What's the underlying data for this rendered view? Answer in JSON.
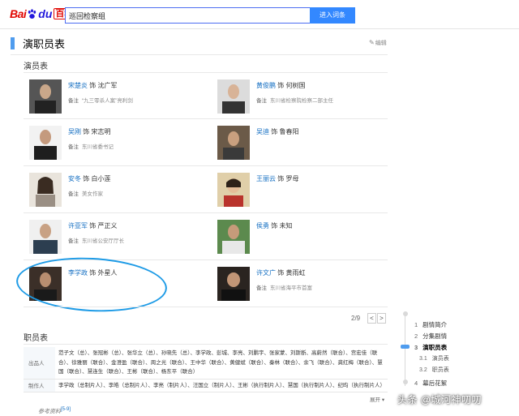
{
  "header": {
    "logo_bai": "Bai",
    "logo_du": "du",
    "logo_baike": "百科",
    "search_value": "巡回检察组",
    "search_button": "进入词条"
  },
  "section": {
    "title": "演职员表",
    "edit": "编辑"
  },
  "cast": {
    "title": "演员表",
    "role_prefix": "饰",
    "note_label": "备注",
    "actors": [
      {
        "name": "宋楚炎",
        "role": "沈广军",
        "note": "“九三零杀人案”亮利剑"
      },
      {
        "name": "黄俊鹏",
        "role": "何树国",
        "note": "东川省检察院检察二部主任"
      },
      {
        "name": "吴刚",
        "role": "宋志明",
        "note": "东川省委书记"
      },
      {
        "name": "吴迪",
        "role": "鲁春阳",
        "note": ""
      },
      {
        "name": "安冬",
        "role": "白小莲",
        "note": "美女作家"
      },
      {
        "name": "王丽云",
        "role": "罗母",
        "note": ""
      },
      {
        "name": "许亚军",
        "role": "严正义",
        "note": "东川省公安厅厅长"
      },
      {
        "name": "侯勇",
        "role": "未知",
        "note": ""
      },
      {
        "name": "李学政",
        "role": "外星人",
        "note": ""
      },
      {
        "name": "许文广",
        "role": "黄雨虹",
        "note": "东川省海平市首富"
      }
    ],
    "pager": "2/9",
    "prev": "<",
    "next": ">"
  },
  "staff": {
    "title": "职员表",
    "rows": [
      {
        "key": "出品人",
        "value": "范子文（总）、张冠彬（总）、张华立（总）、孙晓先（总）、李学政、彭城、李亮、刘鹏宇、张家蒙、刘斯断、高蔚然（联合）、宫宏佳（联合）、徐雅丽（联合）、金澄盈（联合）、周之光（联合）、王中华（联合）、黄健斌（联合）、秦林（联合）、余飞（联合）、龚红梅（联合）、慧国（联合）、慧连生（联合）、王彬（联合）、杨东平（联合）"
      },
      {
        "key": "制作人",
        "value": "李学政（总制片人）、李皓（总制片人）、李亮（制片人）、汪国立（制片人）、王彬（执行制片人）、慧国（执行制片人）、纪昀（执行制片人）"
      }
    ],
    "expand": "展开",
    "refs_label": "参考资料",
    "refs_sup": "[5-9]"
  },
  "toc": {
    "items": [
      {
        "num": "1",
        "label": "剧情简介",
        "level": 1,
        "active": false
      },
      {
        "num": "2",
        "label": "分集剧情",
        "level": 1,
        "active": false
      },
      {
        "num": "3",
        "label": "演职员表",
        "level": 1,
        "active": true
      },
      {
        "num": "3.1",
        "label": "演员表",
        "level": 2,
        "active": false
      },
      {
        "num": "3.2",
        "label": "职员表",
        "level": 2,
        "active": false
      },
      {
        "num": "4",
        "label": "幕后花絮",
        "level": 1,
        "active": false
      }
    ]
  },
  "watermark": "头条 @城河神叨叨",
  "colors": {
    "link_blue": "#136ec2",
    "accent_blue": "#4f9cee",
    "highlight_circle": "#1e9be6",
    "search_button": "#3388ff"
  }
}
